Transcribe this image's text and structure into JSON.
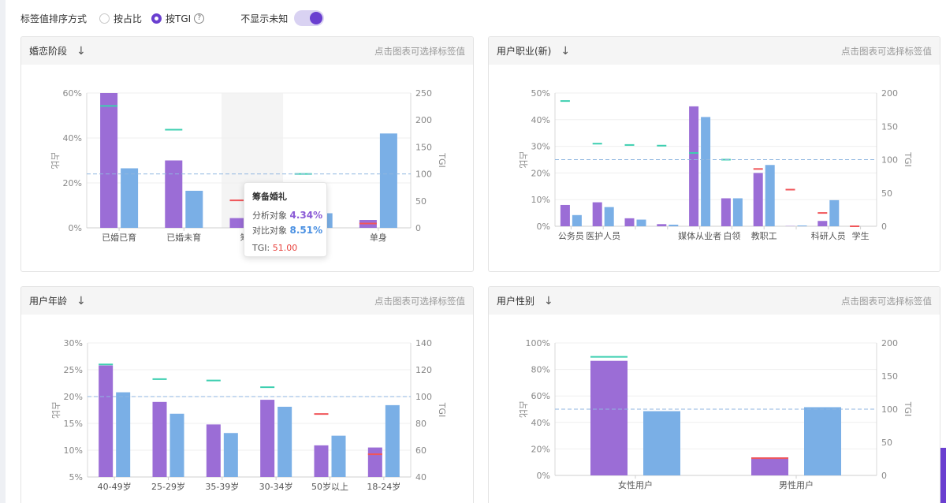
{
  "toolbar": {
    "sort_label": "标签值排序方式",
    "option_ratio": "按占比",
    "option_tgi": "按TGI",
    "help": "?",
    "hide_unknown": "不显示未知"
  },
  "colors": {
    "analysis": "#9b6dd6",
    "compare": "#7aafe6",
    "tgi_high": "#3ecfb0",
    "tgi_low": "#f0565a",
    "ref": "#8fb6e0"
  },
  "panels": [
    {
      "title": "婚恋阶段",
      "hint": "点击图表可选择标签值",
      "sort_icon": "arrow-down-icon",
      "chart_data": {
        "type": "bar",
        "categories": [
          "已婚已育",
          "已婚未育",
          "筹备婚礼",
          "",
          "单身"
        ],
        "category_labels": [
          "已婚已育",
          "已婚未育",
          "筹备",
          "",
          "单身"
        ],
        "series": [
          {
            "values": [
              60,
              30,
              4.34,
              6.5,
              3.5
            ]
          },
          {
            "values": [
              26.5,
              16.5,
              8.51,
              6.5,
              42
            ]
          }
        ],
        "tgi": [
          226,
          182,
          51,
          100,
          8
        ],
        "ylim": [
          0,
          60
        ],
        "y_ticks": [
          "0%",
          "20%",
          "40%",
          "60%"
        ],
        "y2lim": [
          0,
          250
        ],
        "y2_ticks": [
          "0",
          "50",
          "100",
          "150",
          "200",
          "250"
        ],
        "ylabel": "占比",
        "y2label": "TGI",
        "ref_tgi": 100,
        "highlight_index": 2
      }
    },
    {
      "title": "用户职业(新)",
      "hint": "点击图表可选择标签值",
      "sort_icon": "arrow-down-icon",
      "chart_data": {
        "type": "bar",
        "categories": [
          "公务员",
          "医护人员",
          "",
          "",
          "媒体从业者",
          "白领",
          "教职工",
          "",
          "科研人员",
          "学生"
        ],
        "category_labels": [
          "公务员",
          "医护人员",
          "",
          "",
          "媒体从业者",
          "白领",
          "教职工",
          "",
          "科研人员",
          "学生"
        ],
        "series": [
          {
            "values": [
              8,
              9,
              3,
              0.8,
              45,
              10.5,
              20,
              0.1,
              2,
              0
            ]
          },
          {
            "values": [
              4.2,
              7.2,
              2.5,
              0.6,
              41,
              10.5,
              23,
              0.3,
              9.8,
              0
            ]
          }
        ],
        "tgi": [
          188,
          124,
          122,
          121,
          110,
          100,
          86,
          55,
          20,
          0
        ],
        "tgi_order": [
          0,
          1,
          2,
          3,
          5,
          6,
          7,
          8,
          9,
          4
        ],
        "ylim": [
          0,
          50
        ],
        "y_ticks": [
          "0%",
          "10%",
          "20%",
          "30%",
          "40%",
          "50%"
        ],
        "y2lim": [
          0,
          200
        ],
        "y2_ticks": [
          "0",
          "50",
          "100",
          "150",
          "200"
        ],
        "ylabel": "占比",
        "y2label": "TGI",
        "ref_tgi": 100
      }
    },
    {
      "title": "用户年龄",
      "hint": "点击图表可选择标签值",
      "sort_icon": "arrow-down-icon",
      "chart_data": {
        "type": "bar",
        "categories": [
          "40-49岁",
          "25-29岁",
          "35-39岁",
          "30-34岁",
          "50岁以上",
          "18-24岁"
        ],
        "series": [
          {
            "values": [
              25.8,
              19,
              14.8,
              19.4,
              10.9,
              10.5
            ]
          },
          {
            "values": [
              20.8,
              16.8,
              13.2,
              18.1,
              12.7,
              18.4
            ]
          }
        ],
        "tgi": [
          124,
          113,
          112,
          107,
          87,
          57
        ],
        "ylim": [
          5,
          30
        ],
        "y_ticks": [
          "5%",
          "10%",
          "15%",
          "20%",
          "25%",
          "30%"
        ],
        "y2lim": [
          40,
          140
        ],
        "y2_ticks": [
          "40",
          "60",
          "80",
          "100",
          "120",
          "140"
        ],
        "ylabel": "占比",
        "y2label": "TGI",
        "ref_tgi": 100
      }
    },
    {
      "title": "用户性别",
      "hint": "点击图表可选择标签值",
      "sort_icon": "arrow-down-icon",
      "chart_data": {
        "type": "bar",
        "categories": [
          "女性用户",
          "男性用户"
        ],
        "series": [
          {
            "values": [
              86.5,
              13.5
            ]
          },
          {
            "values": [
              48.5,
              51.5
            ]
          }
        ],
        "tgi": [
          179,
          26
        ],
        "ylim": [
          0,
          100
        ],
        "y_ticks": [
          "0%",
          "20%",
          "40%",
          "60%",
          "80%",
          "100%"
        ],
        "y2lim": [
          0,
          200
        ],
        "y2_ticks": [
          "0",
          "50",
          "100",
          "150",
          "200"
        ],
        "ylabel": "占比",
        "y2label": "TGI",
        "ref_tgi": 100
      }
    }
  ],
  "tooltip": {
    "title": "筹备婚礼",
    "analysis_label": "分析对象",
    "analysis_value": "4.34%",
    "compare_label": "对比对象",
    "compare_value": "8.51%",
    "tgi_label": "TGI:",
    "tgi_value": "51.00"
  }
}
